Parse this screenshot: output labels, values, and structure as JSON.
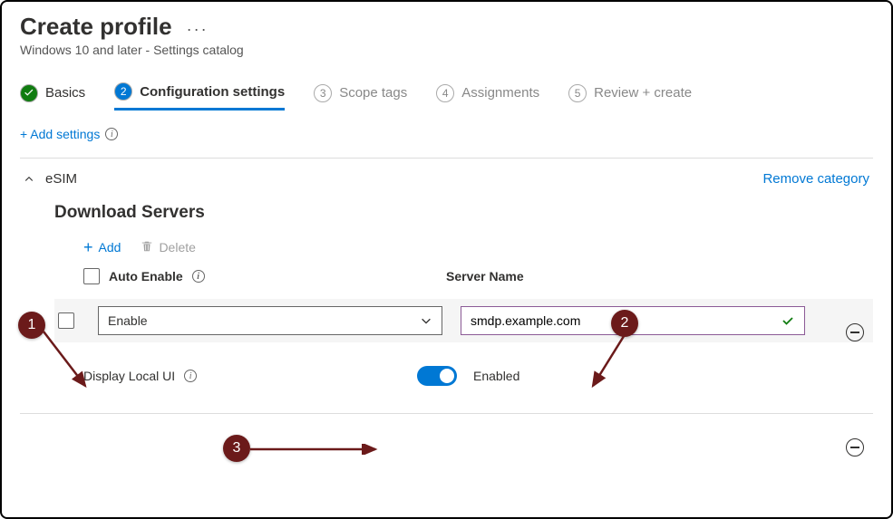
{
  "header": {
    "title": "Create profile",
    "subtitle": "Windows 10 and later - Settings catalog"
  },
  "wizard": {
    "steps": [
      {
        "label": "Basics",
        "state": "done"
      },
      {
        "label": "Configuration settings",
        "state": "active",
        "num": "2"
      },
      {
        "label": "Scope tags",
        "num": "3"
      },
      {
        "label": "Assignments",
        "num": "4"
      },
      {
        "label": "Review + create",
        "num": "5"
      }
    ]
  },
  "add_settings_label": "+ Add settings",
  "category": {
    "name": "eSIM",
    "remove_label": "Remove category",
    "section_title": "Download Servers",
    "toolbar": {
      "add": "Add",
      "delete": "Delete"
    },
    "columns": {
      "auto_enable": "Auto Enable",
      "server_name": "Server Name"
    },
    "row": {
      "dropdown_value": "Enable",
      "server_value": "smdp.example.com"
    },
    "local_ui": {
      "label": "Display Local UI",
      "state": "Enabled"
    }
  },
  "callouts": {
    "one": "1",
    "two": "2",
    "three": "3"
  }
}
